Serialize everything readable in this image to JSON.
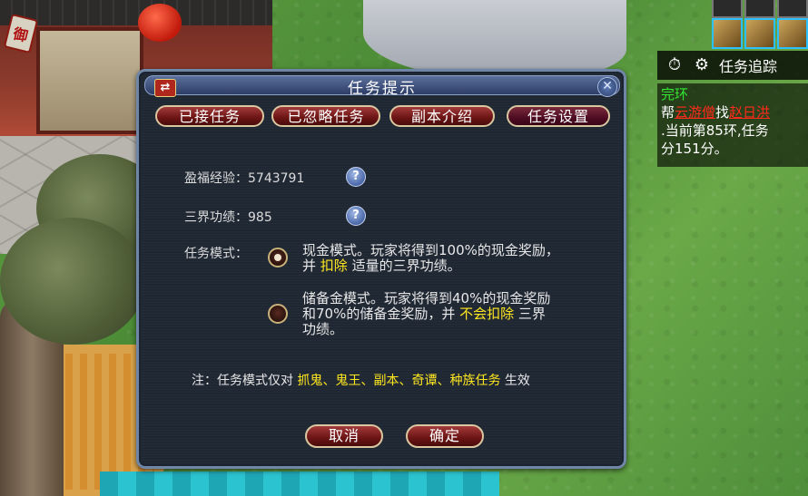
{
  "corner_badge": "御",
  "tracker": {
    "label": "任务追踪",
    "quest_title": "完环",
    "line1_prefix": "帮",
    "line1_npc": "云游僧",
    "line1_mid": "找",
    "line1_target": "赵日洪",
    "line2": ".当前第85环,任务",
    "line3": "分151分。"
  },
  "dialog": {
    "title": "任务提示",
    "close_glyph": "✕",
    "swap_glyph": "⇄",
    "tabs": [
      {
        "label": "已接任务"
      },
      {
        "label": "已忽略任务"
      },
      {
        "label": "副本介绍"
      },
      {
        "label": "任务设置"
      }
    ],
    "exp_label": "盈福经验：5743791",
    "merit_label": "三界功绩：985",
    "help_glyph": "?",
    "mode_label": "任务模式：",
    "option1": {
      "line1": "现金模式。玩家将得到100%的现金奖励，",
      "line2_a": "并 ",
      "line2_b": "扣除",
      "line2_c": " 适量的三界功绩。"
    },
    "option2": {
      "line1": "储备金模式。玩家将得到40%的现金奖励",
      "line2_a": "和70%的储备金奖励，并 ",
      "line2_b": "不会扣除",
      "line2_c": " 三界",
      "line3": "功绩。"
    },
    "note_a": "注：任务模式仅对 ",
    "note_b": "抓鬼、鬼王、副本、奇谭、种族任务",
    "note_c": " 生效",
    "cancel": "取消",
    "confirm": "确定"
  }
}
